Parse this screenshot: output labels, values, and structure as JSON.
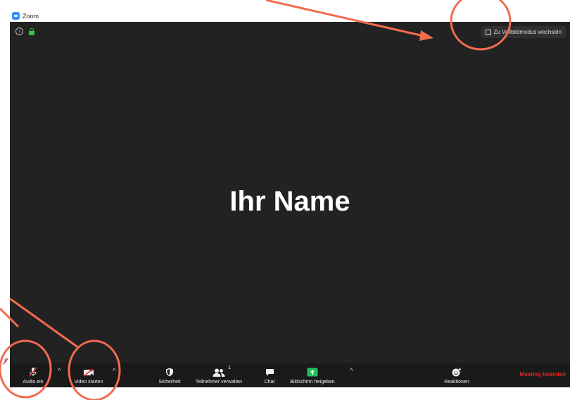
{
  "window": {
    "title": "Zoom"
  },
  "top": {
    "view_button_label": "Zu Vollbildmodus wechseln"
  },
  "participant": {
    "name": "Ihr Name"
  },
  "toolbar": {
    "audio_label": "Audio ein",
    "video_label": "Video starten",
    "security_label": "Sicherheit",
    "participants_label": "Teilnehmer verwalten",
    "participants_count": "1",
    "chat_label": "Chat",
    "share_label": "Bildschirm freigeben",
    "reactions_label": "Reaktionen",
    "end_label": "Meeting beenden"
  },
  "colors": {
    "stage": "#222222",
    "toolbar": "#1a1a1a",
    "share_green": "#22C35A",
    "end_red": "#E02828",
    "lock_green": "#2ECC40",
    "annotation": "#F26B4F"
  },
  "icons": [
    "info-icon",
    "lock-icon",
    "fullscreen-icon",
    "microphone-muted-icon",
    "video-off-icon",
    "shield-icon",
    "participants-icon",
    "chat-icon",
    "share-screen-icon",
    "reactions-icon"
  ]
}
